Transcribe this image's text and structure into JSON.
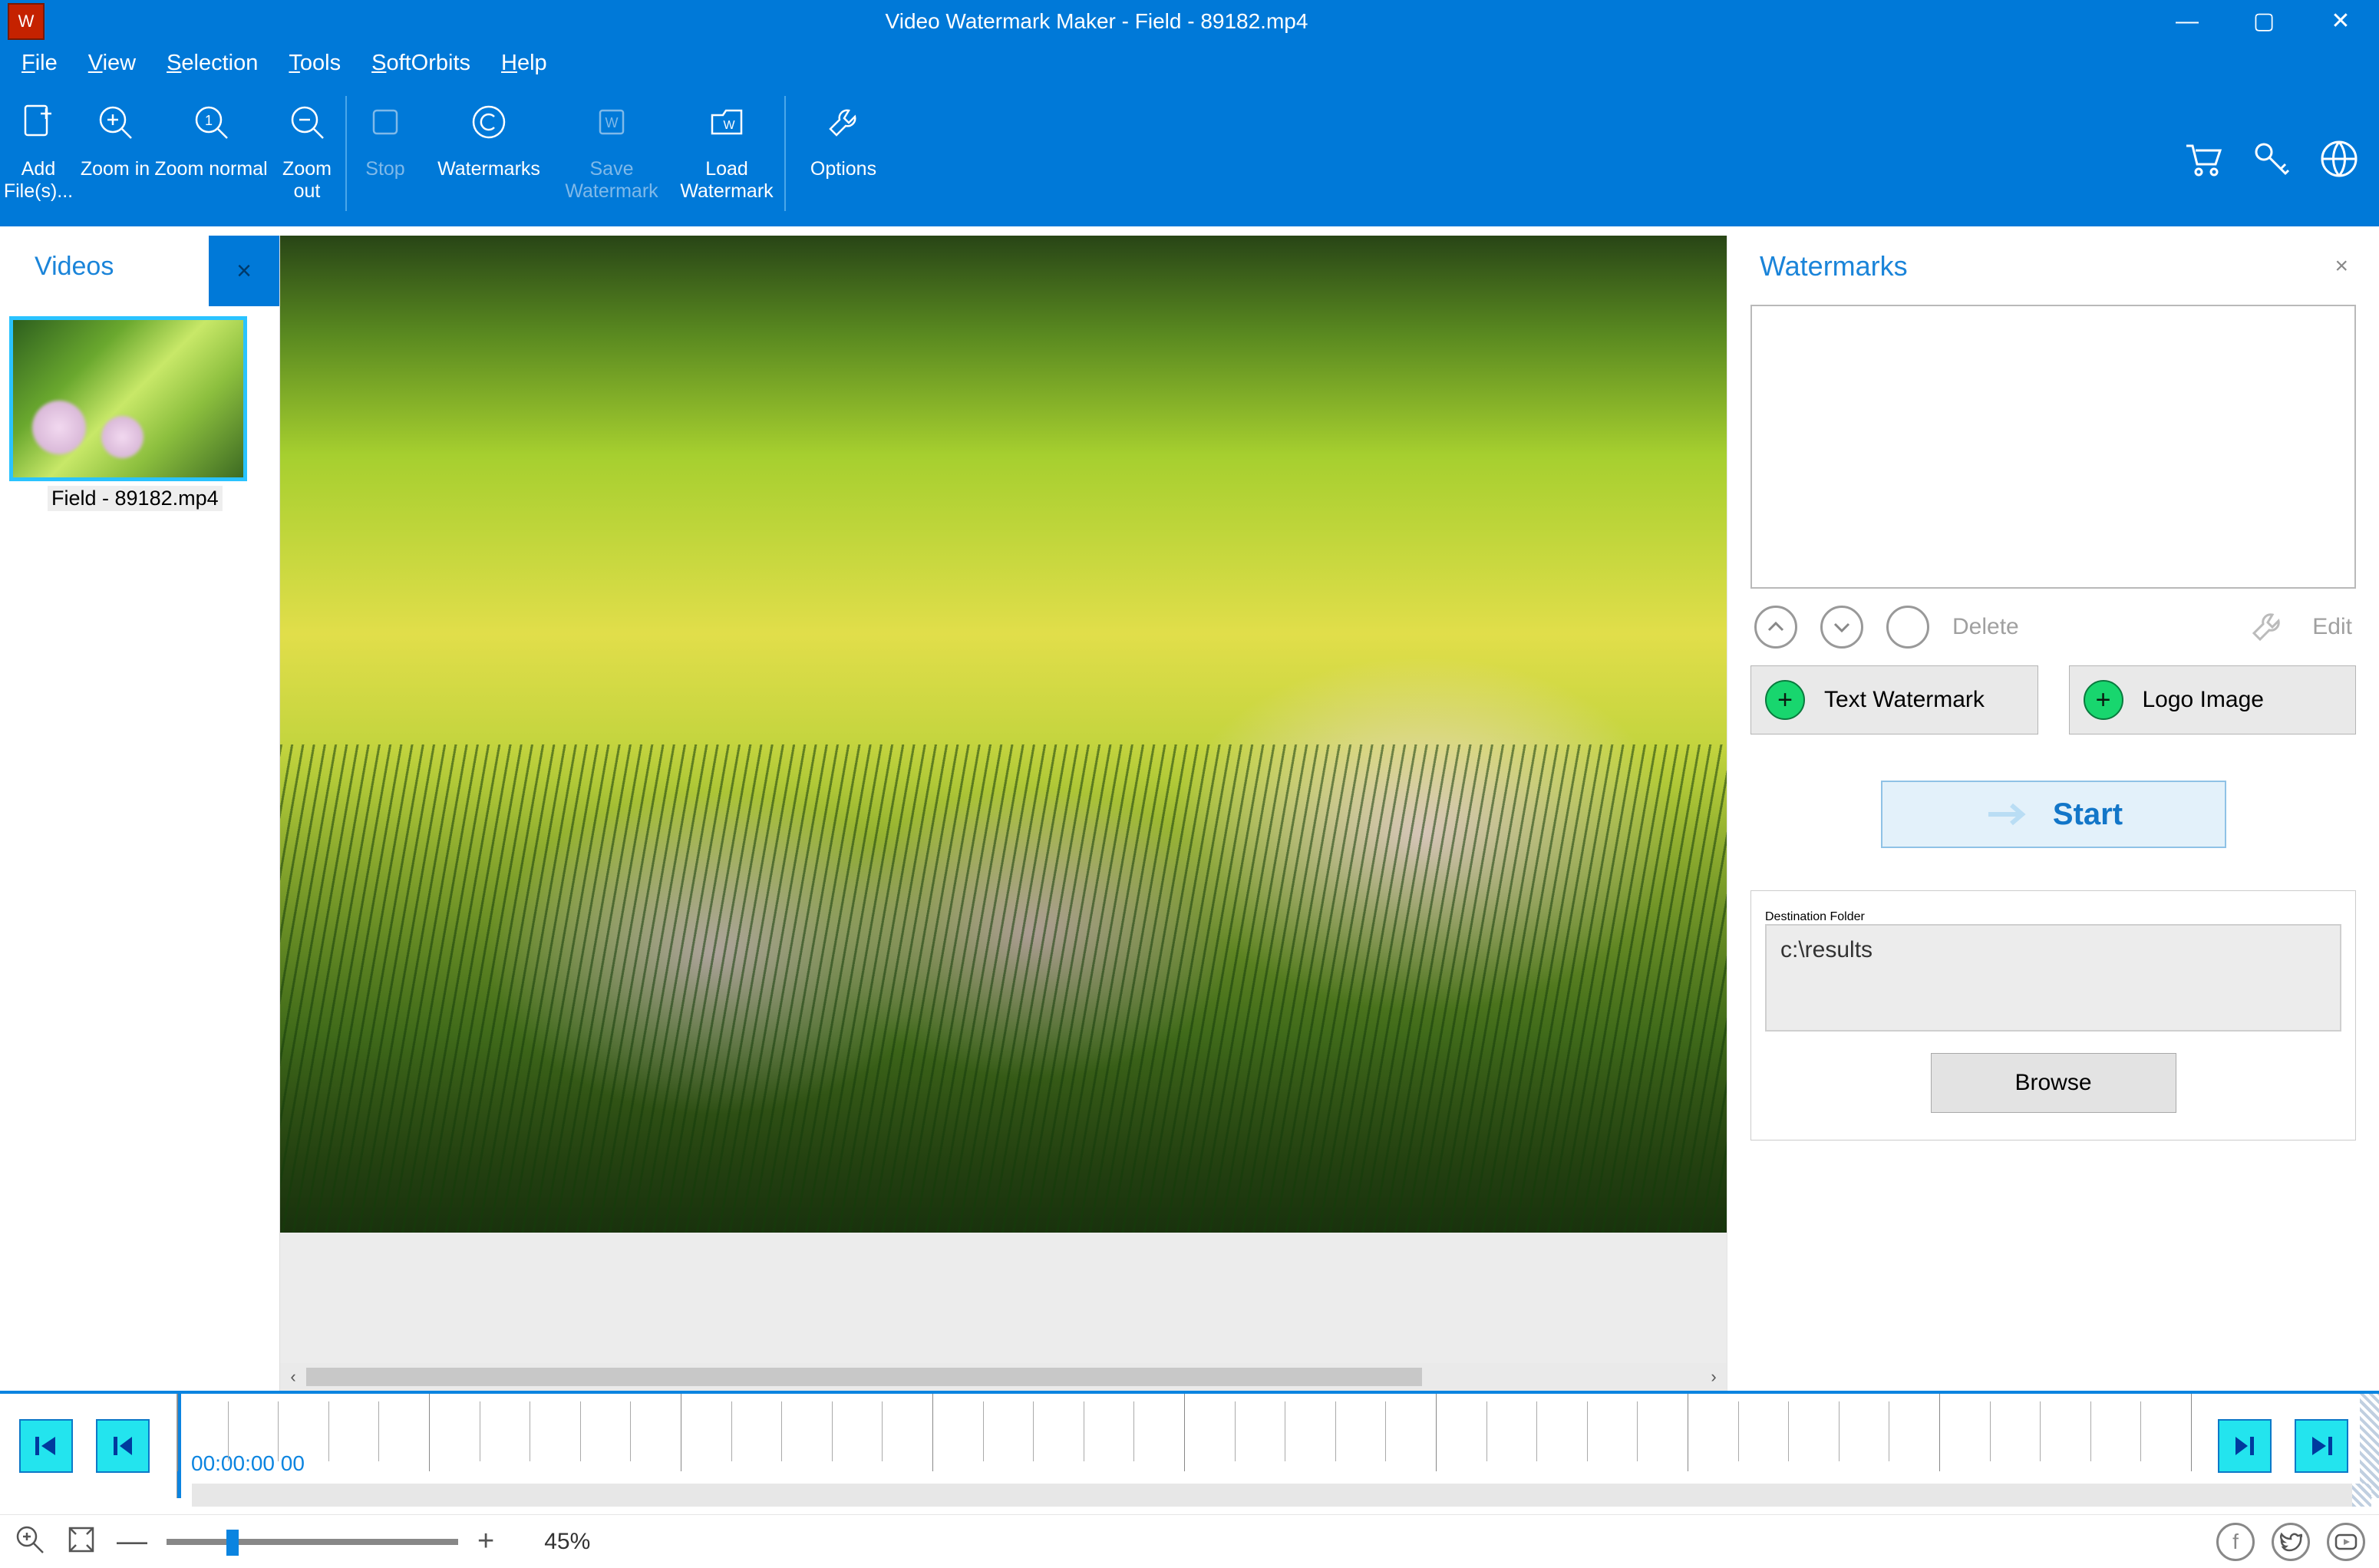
{
  "window": {
    "title": "Video Watermark Maker - Field - 89182.mp4"
  },
  "menu": {
    "file": "File",
    "view": "View",
    "selection": "Selection",
    "tools": "Tools",
    "softorbits": "SoftOrbits",
    "help": "Help"
  },
  "toolbar": {
    "add_files": "Add File(s)...",
    "zoom_in": "Zoom in",
    "zoom_normal": "Zoom normal",
    "zoom_out": "Zoom out",
    "stop": "Stop",
    "watermarks": "Watermarks",
    "save_watermark": "Save Watermark",
    "load_watermark": "Load Watermark",
    "options": "Options"
  },
  "videos_panel": {
    "title": "Videos",
    "close_x": "×",
    "item_name": "Field - 89182.mp4"
  },
  "watermarks_panel": {
    "title": "Watermarks",
    "close_x": "×",
    "delete": "Delete",
    "edit": "Edit",
    "text_watermark": "Text Watermark",
    "logo_image": "Logo Image",
    "start": "Start",
    "dest_label": "Destination Folder",
    "dest_value": "c:\\results",
    "browse": "Browse"
  },
  "timeline": {
    "timecode": "00:00:00 00"
  },
  "status": {
    "zoom_pct": "45%"
  }
}
